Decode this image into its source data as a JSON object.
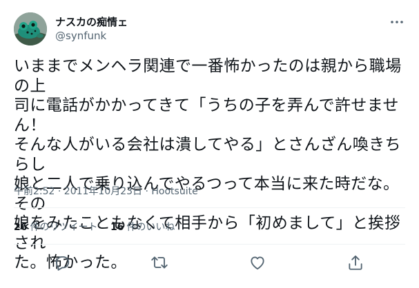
{
  "tweet": {
    "author": {
      "display_name": "ナスカの痴情ェ",
      "handle": "@synfunk",
      "avatar_icon": "frog-avatar"
    },
    "text": "いままでメンヘラ関連で一番怖かったのは親から職場の上\n司に電話がかかってきて「うちの子を弄んで許せません！\nそんな人がいる会社は潰してやる」とさんざん喚きちらし\n娘と二人で乗り込んでやるつって本当に来た時だな。その\n娘をみたこともなくて相手から「初めまして」と挨拶され\nた。怖かった。",
    "meta": "午前2:52 · 2011年10月23日 · Hootsuite",
    "stats": {
      "retweets_count": "26",
      "retweets_label": "件のリツイート",
      "likes_count": "16",
      "likes_label": "件のいいね"
    },
    "actions": {
      "reply_icon": "reply-icon",
      "retweet_icon": "retweet-icon",
      "like_icon": "heart-icon",
      "share_icon": "share-icon"
    }
  },
  "colors": {
    "text_primary": "#0f1419",
    "text_secondary": "#536471",
    "divider": "#eff3f4"
  }
}
